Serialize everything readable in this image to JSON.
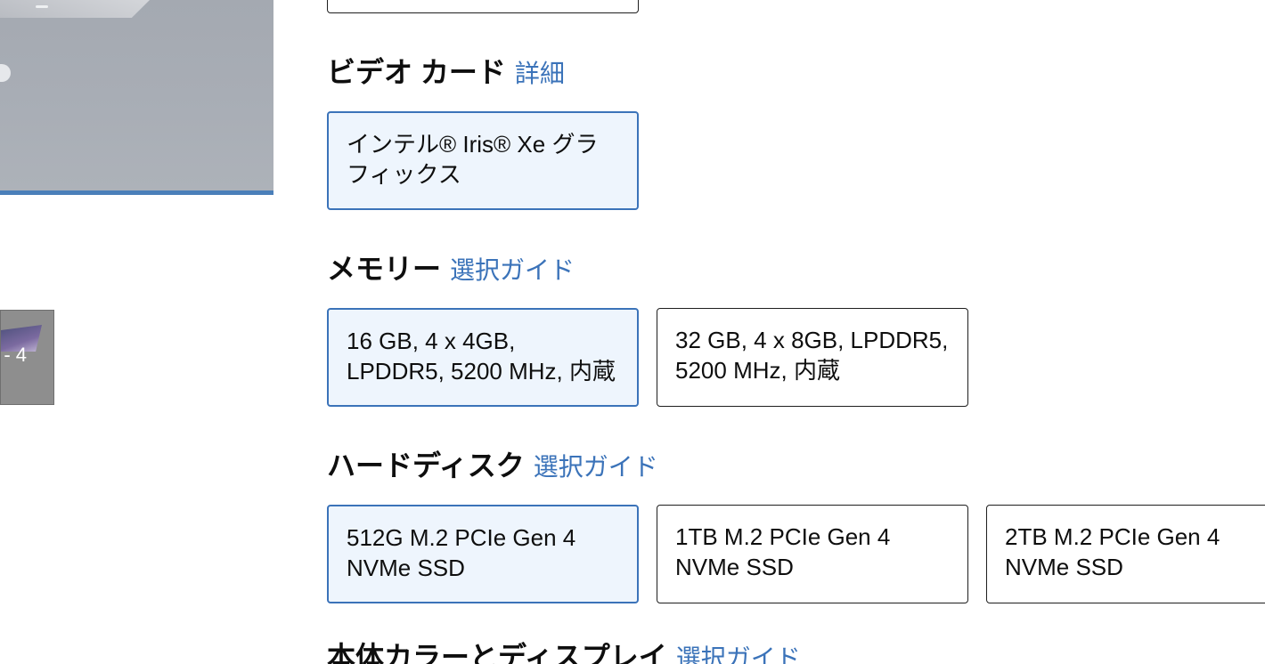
{
  "thumbnail": {
    "label": "- 4"
  },
  "sections": {
    "video_card": {
      "title": "ビデオ カード",
      "link": "詳細",
      "options": [
        {
          "label": "インテル® Iris® Xe グラフィックス",
          "selected": true
        }
      ]
    },
    "memory": {
      "title": "メモリー",
      "link": "選択ガイド",
      "options": [
        {
          "label": "16 GB, 4 x 4GB, LPDDR5, 5200 MHz, 内蔵",
          "selected": true
        },
        {
          "label": "32 GB, 4 x 8GB, LPDDR5, 5200 MHz, 内蔵",
          "selected": false
        }
      ]
    },
    "hard_disk": {
      "title": "ハードディスク",
      "link": "選択ガイド",
      "options": [
        {
          "label": "512G M.2 PCIe Gen 4 NVMe SSD",
          "selected": true
        },
        {
          "label": "1TB M.2 PCIe Gen 4 NVMe SSD",
          "selected": false
        },
        {
          "label": "2TB M.2 PCIe Gen 4 NVMe SSD",
          "selected": false
        }
      ]
    },
    "color_display": {
      "title": "本体カラーとディスプレイ",
      "link": "選択ガイド"
    }
  },
  "colors": {
    "accent": "#3b73b9",
    "selected_bg": "#eef5fd",
    "border": "#1f1f1f"
  }
}
